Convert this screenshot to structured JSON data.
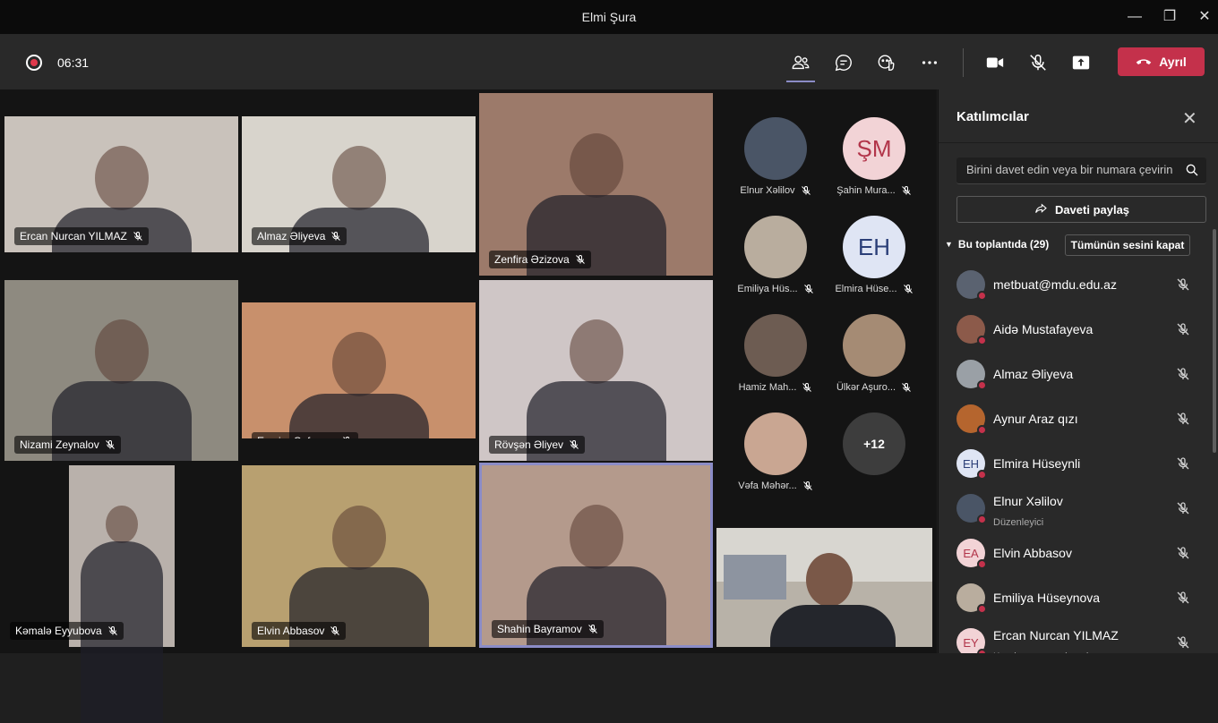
{
  "window": {
    "title": "Elmi Şura"
  },
  "toolbar": {
    "timer": "06:31",
    "leave_label": "Ayrıl"
  },
  "stage": {
    "tiles": [
      {
        "name": "Ercan Nurcan YILMAZ",
        "bg": "#c9c2bb"
      },
      {
        "name": "Almaz Əliyeva",
        "bg": "#d8d4cc"
      },
      {
        "name": "Zenfira Əzizova",
        "bg": "#9c7a6a"
      },
      {
        "name": "Nizami Zeynalov",
        "bg": "#8e8a80"
      },
      {
        "name": "Esmira Cəfərova",
        "bg": "#c8906c"
      },
      {
        "name": "Rövşən Əliyev",
        "bg": "#cfc6c6"
      },
      {
        "name": "Kəmalə Eyyubova",
        "bg": "#b9b1ab"
      },
      {
        "name": "Elvin Abbasov",
        "bg": "#b8a070"
      },
      {
        "name": "Shahin Bayramov",
        "bg": "#b49a8c"
      }
    ],
    "gallery": [
      {
        "name": "Elnur Xəlilov",
        "initials": "",
        "color": "#4a5566"
      },
      {
        "name": "Şahin Mura...",
        "initials": "ŞM",
        "color": "#f2d3d6"
      },
      {
        "name": "Emiliya Hüs...",
        "initials": "",
        "color": "#b9ad9e"
      },
      {
        "name": "Elmira Hüse...",
        "initials": "EH",
        "color": "#dfe5f4"
      },
      {
        "name": "Hamiz Mah...",
        "initials": "",
        "color": "#6d5c52"
      },
      {
        "name": "Ülkər Aşuro...",
        "initials": "",
        "color": "#a58b74"
      },
      {
        "name": "Vəfa Məhər...",
        "initials": "",
        "color": "#c9a692"
      },
      {
        "name": "",
        "initials": "+12",
        "color": "#3d3d3d"
      }
    ]
  },
  "panel": {
    "title": "Katılımcılar",
    "search_placeholder": "Birini davet edin veya bir numara çevirin",
    "share_label": "Daveti paylaş",
    "section_label": "Bu toplantıda (29)",
    "mute_all_label": "Tümünün sesini kapat",
    "participants": [
      {
        "name": "metbuat@mdu.edu.az",
        "role": "",
        "initials": "",
        "color": "#5a6270"
      },
      {
        "name": "Aidə Mustafayeva",
        "role": "",
        "initials": "",
        "color": "#8c5a4a"
      },
      {
        "name": "Almaz Əliyeva",
        "role": "",
        "initials": "",
        "color": "#9aa0a6"
      },
      {
        "name": "Aynur Araz qızı",
        "role": "",
        "initials": "",
        "color": "#b5652e"
      },
      {
        "name": "Elmira Hüseynli",
        "role": "",
        "initials": "EH",
        "color": "#dfe5f4"
      },
      {
        "name": "Elnur Xəlilov",
        "role": "Düzenleyici",
        "initials": "",
        "color": "#4a5566"
      },
      {
        "name": "Elvin Abbasov",
        "role": "",
        "initials": "EA",
        "color": "#f2d3d6"
      },
      {
        "name": "Emiliya Hüseynova",
        "role": "",
        "initials": "",
        "color": "#b9ad9e"
      },
      {
        "name": "Ercan Nurcan YILMAZ",
        "role": "Kuruluşunuzun dışında",
        "initials": "EY",
        "color": "#f2d3d6"
      }
    ]
  }
}
